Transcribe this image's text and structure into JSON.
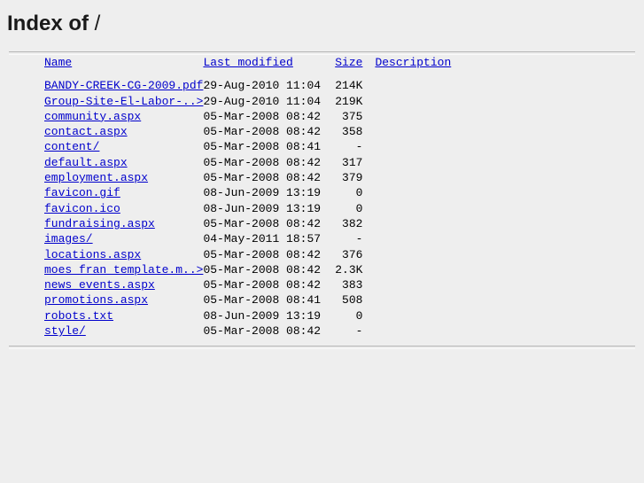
{
  "page": {
    "title_bold": "Index of",
    "title_path": " /"
  },
  "table": {
    "headers": {
      "name": "Name",
      "last_modified": "Last modified",
      "size": "Size",
      "description": "Description"
    },
    "rows": [
      {
        "name": "BANDY-CREEK-CG-2009.pdf",
        "last_modified": "29-Aug-2010 11:04",
        "size": "214K",
        "description": ""
      },
      {
        "name": "Group-Site-El-Labor-..>",
        "last_modified": "29-Aug-2010 11:04",
        "size": "219K",
        "description": ""
      },
      {
        "name": "community.aspx",
        "last_modified": "05-Mar-2008 08:42",
        "size": "375",
        "description": ""
      },
      {
        "name": "contact.aspx",
        "last_modified": "05-Mar-2008 08:42",
        "size": "358",
        "description": ""
      },
      {
        "name": "content/",
        "last_modified": "05-Mar-2008 08:41",
        "size": "-",
        "description": ""
      },
      {
        "name": "default.aspx",
        "last_modified": "05-Mar-2008 08:42",
        "size": "317",
        "description": ""
      },
      {
        "name": "employment.aspx",
        "last_modified": "05-Mar-2008 08:42",
        "size": "379",
        "description": ""
      },
      {
        "name": "favicon.gif",
        "last_modified": "08-Jun-2009 13:19",
        "size": "0",
        "description": ""
      },
      {
        "name": "favicon.ico",
        "last_modified": "08-Jun-2009 13:19",
        "size": "0",
        "description": ""
      },
      {
        "name": "fundraising.aspx",
        "last_modified": "05-Mar-2008 08:42",
        "size": "382",
        "description": ""
      },
      {
        "name": "images/",
        "last_modified": "04-May-2011 18:57",
        "size": "-",
        "description": ""
      },
      {
        "name": "locations.aspx",
        "last_modified": "05-Mar-2008 08:42",
        "size": "376",
        "description": ""
      },
      {
        "name": "moes_fran_template.m..>",
        "last_modified": "05-Mar-2008 08:42",
        "size": "2.3K",
        "description": ""
      },
      {
        "name": "news_events.aspx",
        "last_modified": "05-Mar-2008 08:42",
        "size": "383",
        "description": ""
      },
      {
        "name": "promotions.aspx",
        "last_modified": "05-Mar-2008 08:41",
        "size": "508",
        "description": ""
      },
      {
        "name": "robots.txt",
        "last_modified": "08-Jun-2009 13:19",
        "size": "0",
        "description": ""
      },
      {
        "name": "style/",
        "last_modified": "05-Mar-2008 08:42",
        "size": "-",
        "description": ""
      }
    ]
  },
  "colors": {
    "background": "#eeeeee",
    "link": "#0000cc",
    "text": "#000000",
    "rule": "#b4b4b4"
  }
}
